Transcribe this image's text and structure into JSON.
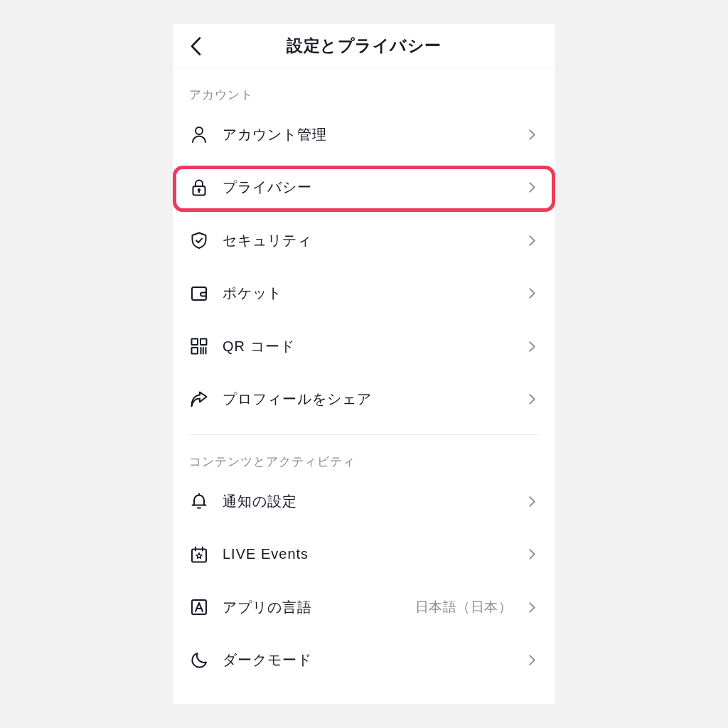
{
  "header": {
    "title": "設定とプライバシー"
  },
  "sections": [
    {
      "title": "アカウント",
      "items": [
        {
          "kind": "account",
          "label": "アカウント管理",
          "highlighted": false
        },
        {
          "kind": "privacy",
          "label": "プライバシー",
          "highlighted": true
        },
        {
          "kind": "security",
          "label": "セキュリティ",
          "highlighted": false
        },
        {
          "kind": "wallet",
          "label": "ポケット",
          "highlighted": false
        },
        {
          "kind": "qr",
          "label": "QR コード",
          "highlighted": false
        },
        {
          "kind": "share",
          "label": "プロフィールをシェア",
          "highlighted": false
        }
      ]
    },
    {
      "title": "コンテンツとアクティビティ",
      "items": [
        {
          "kind": "notifications",
          "label": "通知の設定",
          "highlighted": false
        },
        {
          "kind": "events",
          "label": "LIVE Events",
          "highlighted": false
        },
        {
          "kind": "language",
          "label": "アプリの言語",
          "value": "日本語（日本）",
          "highlighted": false
        },
        {
          "kind": "darkmode",
          "label": "ダークモード",
          "highlighted": false
        }
      ]
    }
  ]
}
